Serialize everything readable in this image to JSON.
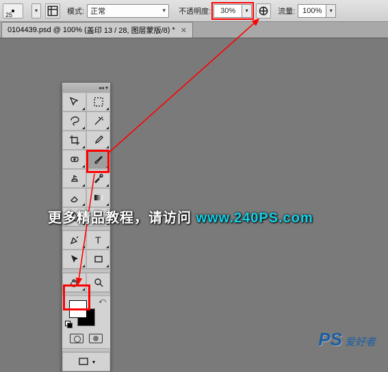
{
  "topbar": {
    "brush_size": "25",
    "mode_label": "模式:",
    "mode_value": "正常",
    "opacity_label": "不透明度:",
    "opacity_value": "30%",
    "flow_label": "流量:",
    "flow_value": "100%"
  },
  "tab": {
    "filename": "0104439.psd",
    "zoom": "100%",
    "layer_info": "盖印 13 / 28, 图层蒙版/8",
    "suffix": "*"
  },
  "tools": {
    "items": [
      {
        "name": "move-tool",
        "selected": false
      },
      {
        "name": "marquee-tool",
        "selected": false
      },
      {
        "name": "lasso-tool",
        "selected": false
      },
      {
        "name": "magic-wand-tool",
        "selected": false
      },
      {
        "name": "crop-tool",
        "selected": false
      },
      {
        "name": "eyedropper-tool",
        "selected": false
      },
      {
        "name": "healing-brush-tool",
        "selected": false
      },
      {
        "name": "brush-tool",
        "selected": true
      },
      {
        "name": "clone-stamp-tool",
        "selected": false
      },
      {
        "name": "history-brush-tool",
        "selected": false
      },
      {
        "name": "eraser-tool",
        "selected": false
      },
      {
        "name": "gradient-tool",
        "selected": false
      },
      {
        "name": "blur-tool",
        "selected": false
      },
      {
        "name": "dodge-tool",
        "selected": false
      },
      {
        "name": "pen-tool",
        "selected": false
      },
      {
        "name": "type-tool",
        "selected": false
      },
      {
        "name": "path-selection-tool",
        "selected": false
      },
      {
        "name": "rectangle-tool",
        "selected": false
      },
      {
        "name": "hand-tool",
        "selected": false
      },
      {
        "name": "zoom-tool",
        "selected": false
      }
    ],
    "foreground_color": "#ffffff",
    "background_color": "#000000"
  },
  "watermark": {
    "text_prefix": "更多精品教程，请访问",
    "url": "www.240PS.com",
    "logo_ps": "PS",
    "logo_rest": "爱好者"
  },
  "highlights": {
    "opacity_box": true,
    "brush_tool": true,
    "foreground_swatch": true
  }
}
